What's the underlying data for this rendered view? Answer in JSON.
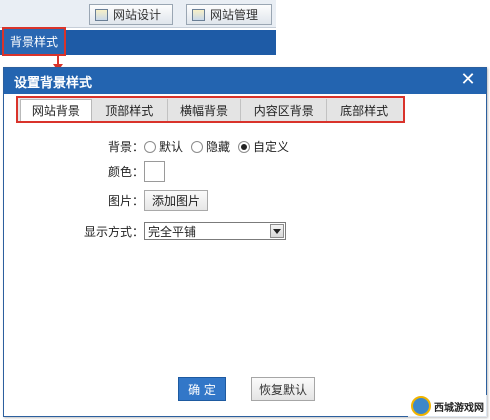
{
  "toolbar": {
    "design_label": "网站设计",
    "manage_label": "网站管理",
    "design_icon": "design-icon",
    "manage_icon": "manage-icon"
  },
  "nav": {
    "bg_style_label": "背景样式"
  },
  "dialog": {
    "title": "设置背景样式",
    "close_icon": "close-icon",
    "tabs": [
      {
        "label": "网站背景",
        "active": true
      },
      {
        "label": "顶部样式",
        "active": false
      },
      {
        "label": "横幅背景",
        "active": false
      },
      {
        "label": "内容区背景",
        "active": false
      },
      {
        "label": "底部样式",
        "active": false
      }
    ],
    "form": {
      "background_label": "背景：",
      "background_options": [
        {
          "label": "默认",
          "checked": false
        },
        {
          "label": "隐藏",
          "checked": false
        },
        {
          "label": "自定义",
          "checked": true
        }
      ],
      "color_label": "颜色：",
      "image_label": "图片：",
      "add_image_button": "添加图片",
      "display_label": "显示方式：",
      "display_value": "完全平铺"
    },
    "ok_button": "确 定",
    "reset_button": "恢复默认"
  },
  "watermark": {
    "text": "西城游戏网"
  },
  "colors": {
    "accent_blue": "#2364b0",
    "highlight_red": "#d9332b"
  }
}
